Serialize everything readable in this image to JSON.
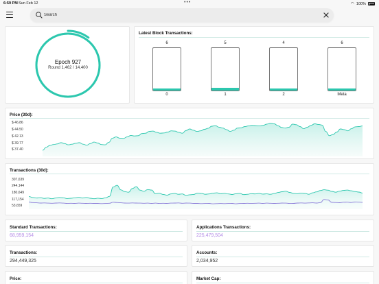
{
  "status_bar": {
    "time": "6:59 PM",
    "date": "Sun Feb 12",
    "battery": "100%"
  },
  "search": {
    "placeholder": "Search"
  },
  "epoch": {
    "label": "Epoch 927",
    "round": "Round 1,462 / 14,400",
    "progress": 0.1015
  },
  "blocks": {
    "title": "Latest Block Transactions:",
    "items": [
      {
        "name": "0",
        "count": "6",
        "fill": 0.04
      },
      {
        "name": "1",
        "count": "5",
        "fill": 0.06
      },
      {
        "name": "2",
        "count": "4",
        "fill": 0.04
      },
      {
        "name": "Meta",
        "count": "6",
        "fill": 0.04
      }
    ]
  },
  "price_chart": {
    "title": "Price (30d):",
    "yticks": [
      "$ 46.86",
      "$ 44.50",
      "$ 42.13",
      "$ 39.77",
      "$ 37.40"
    ]
  },
  "tx_chart": {
    "title": "Transactions (30d):",
    "yticks": [
      "307,639",
      "244,144",
      "180,649",
      "117,154",
      "53,659"
    ]
  },
  "stats": {
    "standard": {
      "title": "Standard Transactions:",
      "value": "68,959,154"
    },
    "applications": {
      "title": "Applications Transactions:",
      "value": "225,479,504"
    },
    "transactions": {
      "title": "Transactions:",
      "value": "294,449,325"
    },
    "accounts": {
      "title": "Accounts:",
      "value": "2,034,952"
    },
    "price": {
      "title": "Price:"
    },
    "market_cap": {
      "title": "Market Cap:"
    }
  },
  "colors": {
    "accent": "#2cc7ae",
    "accent_light": "#9ae6d8",
    "purple": "#8a7bd8"
  },
  "chart_data": [
    {
      "type": "area",
      "title": "Price (30d):",
      "ylim": [
        37.4,
        46.86
      ],
      "values": [
        37.6,
        38.6,
        39.2,
        39.5,
        39.7,
        40.1,
        39.8,
        39.4,
        39.6,
        39.9,
        40.1,
        39.6,
        39.3,
        39.8,
        40.3,
        40.0,
        39.5,
        39.4,
        40.2,
        41.6,
        42.0,
        41.6,
        41.5,
        42.0,
        42.5,
        42.3,
        42.4,
        43.1,
        43.2,
        43.8,
        43.9,
        43.5,
        43.2,
        43.3,
        43.6,
        44.0,
        43.9,
        43.5,
        43.2,
        44.1,
        44.6,
        44.2,
        43.8,
        44.0,
        44.5,
        44.8,
        45.5,
        45.7,
        45.2,
        44.9,
        44.4,
        43.8,
        44.2,
        44.9,
        45.0,
        45.4,
        45.6,
        45.8,
        45.7,
        45.6,
        45.8,
        46.2,
        46.5,
        46.3,
        45.7,
        45.1,
        44.9,
        45.2,
        46.2,
        46.0,
        45.4,
        44.7,
        45.2,
        45.8,
        46.3,
        46.1,
        45.9,
        43.8,
        42.4,
        42.8,
        43.6,
        44.6,
        44.4,
        44.0,
        44.7,
        45.3,
        45.4,
        45.6
      ]
    },
    {
      "type": "line",
      "title": "Transactions (30d):",
      "ylim": [
        53659,
        307639
      ],
      "series": [
        {
          "values": [
            150000,
            141000,
            136000,
            139000,
            133000,
            136000,
            130000,
            136000,
            141000,
            138000,
            132000,
            134000,
            138000,
            142000,
            136000,
            141000,
            134000,
            130000,
            135000,
            132000,
            138000,
            151000,
            236000,
            251000,
            210000,
            194000,
            189000,
            222000,
            239000,
            207000,
            197000,
            213000,
            208000,
            176000,
            180000,
            169000,
            162000,
            173000,
            178000,
            170000,
            173000,
            161000,
            166000,
            169000,
            181000,
            178000,
            170000,
            173000,
            180000,
            183000,
            176000,
            179000,
            173000,
            168000,
            175000,
            179000,
            167000,
            170000,
            176000,
            173000,
            178000,
            172000,
            174000,
            170000,
            177000,
            186000,
            193000,
            198000,
            187000,
            178000,
            176000,
            181000,
            178000,
            170000,
            183000,
            192000,
            204000,
            211000,
            207000,
            196000,
            189000,
            198000,
            205000,
            208000,
            202000,
            195000,
            190000,
            181000
          ]
        },
        {
          "values": [
            100000,
            95000,
            93000,
            91000,
            92000,
            90000,
            89000,
            91000,
            92000,
            90000,
            87000,
            89000,
            88000,
            90000,
            89000,
            88000,
            89000,
            88000,
            88000,
            86000,
            87000,
            89000,
            98000,
            96000,
            93000,
            91000,
            90000,
            92000,
            91000,
            90000,
            89000,
            90000,
            88000,
            90000,
            87000,
            89000,
            88000,
            90000,
            91000,
            92000,
            89000,
            91000,
            90000,
            88000,
            88000,
            86000,
            87000,
            88000,
            84000,
            86000,
            87000,
            86000,
            87000,
            88000,
            84000,
            87000,
            88000,
            89000,
            87000,
            89000,
            90000,
            88000,
            90000,
            89000,
            88000,
            89000,
            91000,
            90000,
            87000,
            88000,
            91000,
            92000,
            90000,
            92000,
            93000,
            91000,
            95000,
            123000,
            119000,
            97000,
            96000,
            94000,
            98000,
            99000,
            96000,
            100000,
            99000,
            97000
          ]
        }
      ]
    }
  ]
}
